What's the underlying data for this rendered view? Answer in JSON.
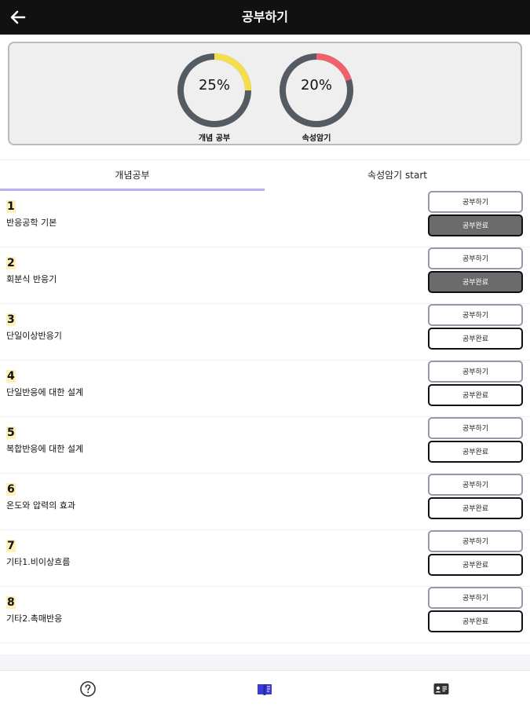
{
  "header": {
    "title": "공부하기",
    "back_icon": "back-arrow-icon"
  },
  "progress": {
    "concept": {
      "percent_label": "25%",
      "label": "개념 공부",
      "value": 25,
      "color": "#f6de4a"
    },
    "memorize": {
      "percent_label": "20%",
      "label": "속성암기",
      "value": 20,
      "color": "#f0616b"
    },
    "track_color": "#555b63"
  },
  "tabs": [
    {
      "label": "개념공부",
      "active": true
    },
    {
      "label": "속성암기 start",
      "active": false
    }
  ],
  "buttons": {
    "study_label": "공부하기",
    "done_label": "공부완료"
  },
  "items": [
    {
      "number": "1",
      "title": "반응공학 기본",
      "completed": true
    },
    {
      "number": "2",
      "title": "회분식 반응기",
      "completed": true
    },
    {
      "number": "3",
      "title": "단일이상반응기",
      "completed": false
    },
    {
      "number": "4",
      "title": "단일반응에 대한 설계",
      "completed": false
    },
    {
      "number": "5",
      "title": "복합반응에 대한 설계",
      "completed": false
    },
    {
      "number": "6",
      "title": "온도와 압력의 효과",
      "completed": false
    },
    {
      "number": "7",
      "title": "기타1.비이상흐름",
      "completed": false
    },
    {
      "number": "8",
      "title": "기타2.촉매반응",
      "completed": false
    }
  ],
  "bottom_nav": [
    {
      "icon": "help-circle-icon"
    },
    {
      "icon": "book-icon",
      "active": true,
      "color": "#3b3bd6"
    },
    {
      "icon": "id-card-icon"
    }
  ]
}
